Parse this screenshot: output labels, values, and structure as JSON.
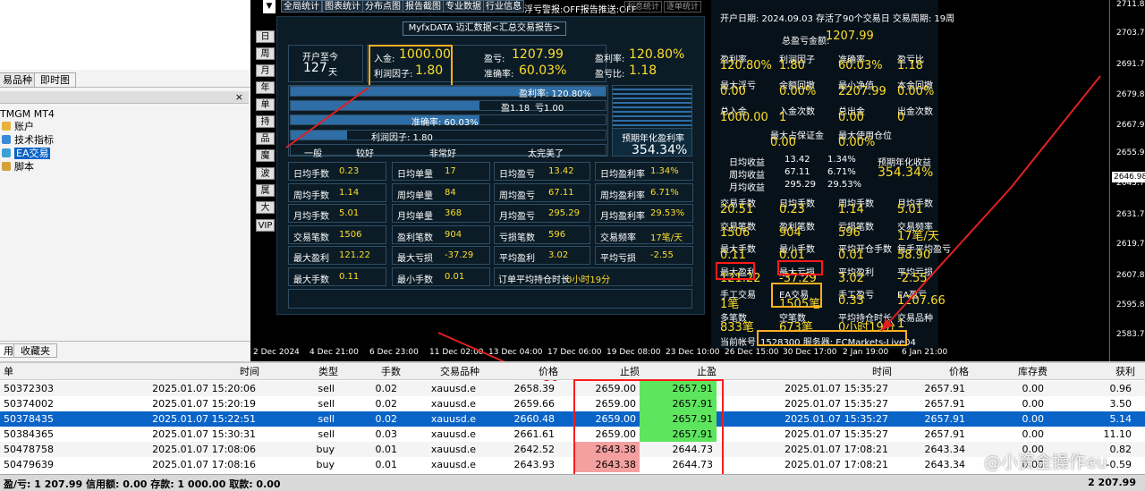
{
  "left_panel": {
    "nav_tabs": [
      "易品种",
      "即时图"
    ],
    "tree_root": "TMGM MT4",
    "tree_items": [
      "账户",
      "技术指标",
      "EA交易",
      "脚本"
    ],
    "bottom_tabs": [
      "用",
      "收藏夹"
    ],
    "close": "×"
  },
  "top_buttons": [
    "全局统计",
    "图表统计",
    "分布点图",
    "报告截图",
    "专业数据",
    "行业信息"
  ],
  "top_warning": "浮亏警报:OFF报告推送:OFF",
  "top_warning_buttons": [
    "利息统计",
    "逐单统计"
  ],
  "side_buttons": [
    "日",
    "周",
    "月",
    "年",
    "单币",
    "持仓",
    "品种",
    "魔号",
    "波幅",
    "属性",
    "大字",
    "VIP"
  ],
  "dashboard": {
    "title": "MyfxDATA 迈汇数据<汇总交易报告>",
    "since_label": "开户至今",
    "since_value": "127",
    "since_unit": "天",
    "deposit_label": "入金:",
    "deposit_value": "1000.00",
    "profit_factor_label": "利润因子:",
    "profit_factor_value": "1.80",
    "pnl_label": "盈亏:",
    "pnl_value": "1207.99",
    "winrate_label": "准确率:",
    "winrate_value": "60.03%",
    "return_label": "盈利率:",
    "return_value": "120.80%",
    "pnl_ratio_label": "盈亏比:",
    "pnl_ratio_value": "1.18",
    "bars": [
      {
        "label": "盈利率: 120.80%",
        "fill": 1.0
      },
      {
        "label": "盈1.18",
        "label2": "亏1.00",
        "fill": 0.6
      },
      {
        "label": "准确率: 60.03%",
        "fill": 0.6
      },
      {
        "label": "利润因子: 1.80",
        "fill": 0.18
      }
    ],
    "scale": [
      "一般",
      "较好",
      "非常好",
      "太完美了"
    ],
    "annual_label": "预期年化盈利率",
    "annual_value": "354.34%",
    "grid": [
      [
        "日均手数",
        "0.23",
        "日均单量",
        "17",
        "日均盈亏",
        "13.42",
        "日均盈利率",
        "1.34%"
      ],
      [
        "周均手数",
        "1.14",
        "周均单量",
        "84",
        "周均盈亏",
        "67.11",
        "周均盈利率",
        "6.71%"
      ],
      [
        "月均手数",
        "5.01",
        "月均单量",
        "368",
        "月均盈亏",
        "295.29",
        "月均盈利率",
        "29.53%"
      ],
      [
        "交易笔数",
        "1506",
        "盈利笔数",
        "904",
        "亏损笔数",
        "596",
        "交易频率",
        "17笔/天"
      ],
      [
        "最大盈利",
        "121.22",
        "最大亏损",
        "-37.29",
        "平均盈利",
        "3.02",
        "平均亏损",
        "-2.55"
      ],
      [
        "最大手数",
        "0.11",
        "最小手数",
        "0.01",
        "订单平均持仓时长",
        "0小时19分",
        "",
        ""
      ]
    ]
  },
  "right_panel": {
    "open_info": "开户日期: 2024.09.03 存活了90个交易日 交易周期: 19周",
    "total_label": "总盈亏金额:",
    "total_value": "1207.99",
    "stats": [
      [
        "盈利率",
        "120.80%",
        "利润因子",
        "1.80",
        "准确率",
        "60.03%",
        "盈亏比",
        "1.18"
      ],
      [
        "最大浮亏",
        "0.00",
        "余额回撤",
        "0.00%",
        "最小净值",
        "2207.99",
        "本金回撤",
        "0.00%"
      ],
      [
        "总入金",
        "1000.00",
        "入金次数",
        "1",
        "总出金",
        "0.00",
        "出金次数",
        "0"
      ]
    ],
    "margin": [
      "最大占保证金",
      "0.00",
      "最大使用仓位",
      "0.00%"
    ],
    "period": [
      [
        "日均收益",
        "13.42",
        "1.34%"
      ],
      [
        "周均收益",
        "67.11",
        "6.71%"
      ],
      [
        "月均收益",
        "295.29",
        "29.53%"
      ]
    ],
    "annual_label": "预期年化收益",
    "annual_value": "354.34%",
    "stats2": [
      [
        "交易手数",
        "20.51",
        "日均手数",
        "0.23",
        "周均手数",
        "1.14",
        "月均手数",
        "5.01"
      ],
      [
        "交易笔数",
        "1506",
        "盈利笔数",
        "904",
        "亏损笔数",
        "596",
        "交易频率",
        "17笔/天"
      ],
      [
        "最大手数",
        "0.11",
        "最小手数",
        "0.01",
        "平均开仓手数",
        "0.01",
        "每手平均盈亏",
        "58.90"
      ],
      [
        "最大盈利",
        "121.22",
        "最大亏损",
        "-37.29",
        "平均盈利",
        "3.02",
        "平均亏损",
        "-2.55"
      ],
      [
        "手工交易",
        "1笔",
        "EA交易",
        "1505笔",
        "手工盈亏",
        "0.33",
        "EA盈亏",
        "1207.66"
      ],
      [
        "多笔数",
        "833笔",
        "空笔数",
        "673笔",
        "平均持仓时长",
        "0小时19分",
        "交易品种",
        "1"
      ]
    ],
    "account_label": "当前帐号:",
    "account_value": "1528300 服务器: ECMarkets-Live04"
  },
  "y_axis": [
    "2711.85",
    "2703.70",
    "2691.70",
    "2679.85",
    "2667.90",
    "2655.95",
    "2646.98",
    "2643.70",
    "2631.70",
    "2619.75",
    "2607.80",
    "2595.85",
    "2583.70"
  ],
  "x_axis": [
    "2 Dec 2024",
    "4 Dec 21:00",
    "6 Dec 23:00",
    "11 Dec 02:00",
    "13 Dec 04:00",
    "17 Dec 06:00",
    "19 Dec 08:00",
    "23 Dec 10:00",
    "26 Dec 15:00",
    "30 Dec 17:00",
    "2 Jan 19:00",
    "6 Jan 21:00"
  ],
  "table": {
    "headers": [
      "单",
      "时间",
      "类型",
      "手数",
      "交易品种",
      "价格",
      "止损",
      "止盈",
      "时间",
      "价格",
      "库存费",
      "获利"
    ],
    "rows": [
      [
        "50372303",
        "2025.01.07 15:20:06",
        "sell",
        "0.02",
        "xauusd.e",
        "2658.39",
        "2659.00",
        "2657.91",
        "2025.01.07 15:35:27",
        "2657.91",
        "0.00",
        "0.96"
      ],
      [
        "50374002",
        "2025.01.07 15:20:19",
        "sell",
        "0.02",
        "xauusd.e",
        "2659.66",
        "2659.00",
        "2657.91",
        "2025.01.07 15:35:27",
        "2657.91",
        "0.00",
        "3.50"
      ],
      [
        "50378435",
        "2025.01.07 15:22:51",
        "sell",
        "0.02",
        "xauusd.e",
        "2660.48",
        "2659.00",
        "2657.91",
        "2025.01.07 15:35:27",
        "2657.91",
        "0.00",
        "5.14"
      ],
      [
        "50384365",
        "2025.01.07 15:30:31",
        "sell",
        "0.03",
        "xauusd.e",
        "2661.61",
        "2659.00",
        "2657.91",
        "2025.01.07 15:35:27",
        "2657.91",
        "0.00",
        "11.10"
      ],
      [
        "50478758",
        "2025.01.07 17:08:06",
        "buy",
        "0.01",
        "xauusd.e",
        "2642.52",
        "2643.38",
        "2644.73",
        "2025.01.07 17:08:21",
        "2643.34",
        "0.00",
        "0.82"
      ],
      [
        "50479639",
        "2025.01.07 17:08:16",
        "buy",
        "0.01",
        "xauusd.e",
        "2643.93",
        "2643.38",
        "2644.73",
        "2025.01.07 17:08:21",
        "2643.34",
        "0.00",
        "-0.59"
      ]
    ],
    "selected_row": 2
  },
  "status_bar": {
    "summary": "盈/亏: 1 207.99 信用额: 0.00 存款: 1 000.00 取款: 0.00",
    "total": "2 207.99"
  },
  "watermark": "@小资金操作eu",
  "colors": {
    "accent_yellow": "#ffde28",
    "highlight_orange": "#ffb020",
    "highlight_red": "#ff1a1a",
    "tp_green": "#5ee55e",
    "sl_red": "#f4a0a0",
    "select_blue": "#0a64c8"
  }
}
